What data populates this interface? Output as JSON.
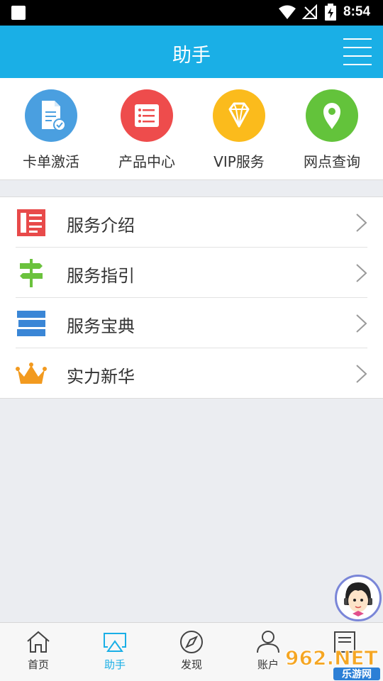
{
  "status_bar": {
    "time": "8:54"
  },
  "header": {
    "title": "助手"
  },
  "quick_actions": [
    {
      "label": "卡单激活",
      "icon": "card-activate-icon",
      "color": "#4a9fe0"
    },
    {
      "label": "产品中心",
      "icon": "product-list-icon",
      "color": "#ee4c4c"
    },
    {
      "label": "VIP服务",
      "icon": "diamond-icon",
      "color": "#fbbb1c"
    },
    {
      "label": "网点查询",
      "icon": "location-pin-icon",
      "color": "#63c33b"
    }
  ],
  "menu_items": [
    {
      "label": "服务介绍",
      "icon": "newspaper-icon"
    },
    {
      "label": "服务指引",
      "icon": "signpost-icon"
    },
    {
      "label": "服务宝典",
      "icon": "stack-icon"
    },
    {
      "label": "实力新华",
      "icon": "crown-icon"
    }
  ],
  "tabs": [
    {
      "label": "首页",
      "icon": "home-icon",
      "active": false
    },
    {
      "label": "助手",
      "icon": "airplay-icon",
      "active": true
    },
    {
      "label": "发现",
      "icon": "compass-icon",
      "active": false
    },
    {
      "label": "账户",
      "icon": "user-icon",
      "active": false
    },
    {
      "label": "",
      "icon": "list-icon",
      "active": false
    }
  ],
  "watermark": {
    "top": "962.NET",
    "bottom": "乐游网"
  },
  "colors": {
    "primary": "#1aafe6",
    "background": "#ebedf1"
  }
}
